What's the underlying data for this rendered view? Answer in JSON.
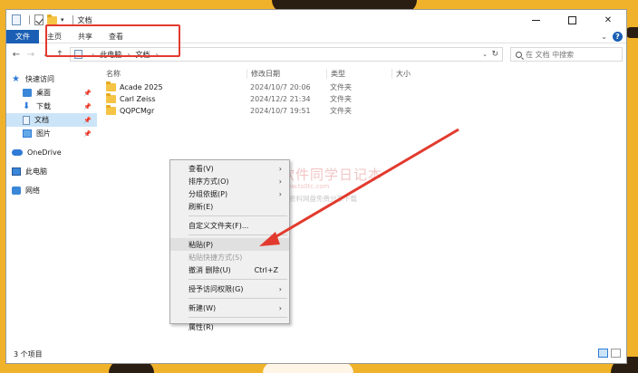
{
  "window": {
    "title": "文档",
    "controls": {
      "minimize": "—",
      "maximize": "☐",
      "close": "✕"
    }
  },
  "ribbon": {
    "file": "文件",
    "tabs": [
      "主页",
      "共享",
      "查看"
    ]
  },
  "address": {
    "segments": [
      "此电脑",
      "文档"
    ]
  },
  "search": {
    "placeholder": "在 文档 中搜索"
  },
  "sidebar": {
    "quick_access": "快速访问",
    "items": [
      {
        "label": "桌面",
        "pinned": true
      },
      {
        "label": "下载",
        "pinned": true
      },
      {
        "label": "文档",
        "pinned": true,
        "selected": true
      },
      {
        "label": "图片",
        "pinned": true
      }
    ],
    "onedrive": "OneDrive",
    "this_pc": "此电脑",
    "network": "网络"
  },
  "columns": {
    "name": "名称",
    "date": "修改日期",
    "type": "类型",
    "size": "大小"
  },
  "files": [
    {
      "name": "Acade 2025",
      "date": "2024/10/7 20:06",
      "type": "文件夹"
    },
    {
      "name": "Carl Zeiss",
      "date": "2024/12/2 21:34",
      "type": "文件夹"
    },
    {
      "name": "QQPCMgr",
      "date": "2024/10/7 19:51",
      "type": "文件夹"
    }
  ],
  "context_menu": {
    "items": [
      {
        "label": "查看(V)",
        "submenu": true
      },
      {
        "label": "排序方式(O)",
        "submenu": true
      },
      {
        "label": "分组依据(P)",
        "submenu": true
      },
      {
        "label": "刷新(E)"
      },
      {
        "label": "自定义文件夹(F)..."
      },
      {
        "label": "粘贴(P)",
        "highlighted": true
      },
      {
        "label": "粘贴快捷方式(S)",
        "disabled": true
      },
      {
        "label": "撤消 删除(U)",
        "shortcut": "Ctrl+Z"
      },
      {
        "label": "授予访问权限(G)",
        "submenu": true
      },
      {
        "label": "新建(W)",
        "submenu": true
      },
      {
        "label": "属性(R)"
      }
    ]
  },
  "watermark": {
    "title": "软件同学日记本",
    "url": "www.ts0tc.com",
    "subtitle": "软件、资源、资料网盘免费分享下载"
  },
  "status": {
    "count": "3 个项目"
  },
  "colors": {
    "accent": "#1a5fb4",
    "annotation_red": "#e23a2e",
    "wallpaper": "#f0b22a",
    "selection": "#cce4f7"
  }
}
